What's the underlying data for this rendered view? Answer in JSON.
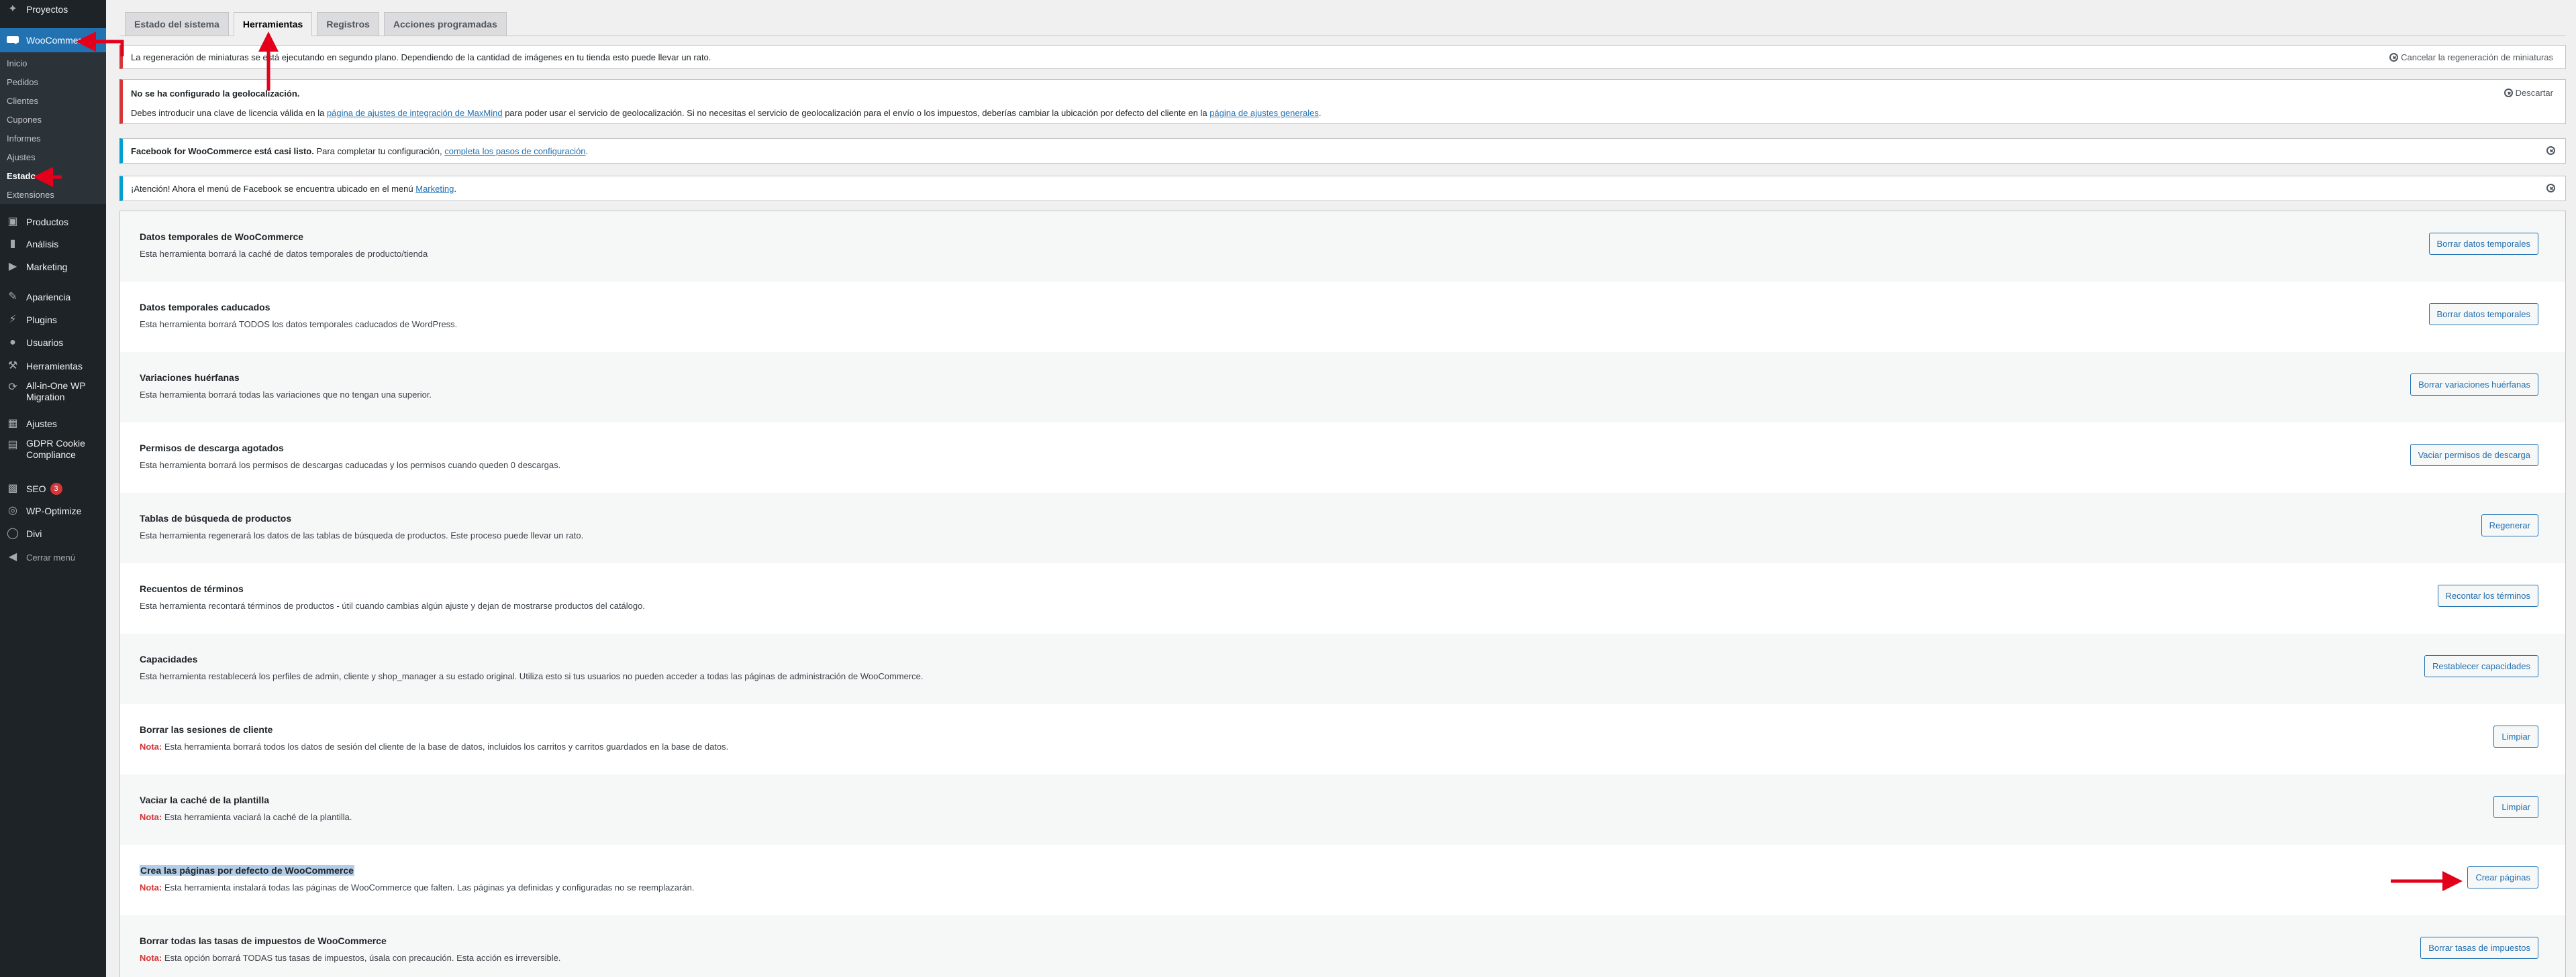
{
  "sidebar": {
    "top_items": [
      {
        "label": "Proyectos",
        "icon": "pin-icon"
      },
      {
        "label": "WooCommerce",
        "icon": "woocommerce-icon"
      }
    ],
    "submenu": [
      {
        "label": "Inicio"
      },
      {
        "label": "Pedidos"
      },
      {
        "label": "Clientes"
      },
      {
        "label": "Cupones"
      },
      {
        "label": "Informes"
      },
      {
        "label": "Ajustes"
      },
      {
        "label": "Estado"
      },
      {
        "label": "Extensiones"
      }
    ],
    "items": [
      {
        "label": "Productos",
        "icon": "archive-icon"
      },
      {
        "label": "Análisis",
        "icon": "chart-bar-icon"
      },
      {
        "label": "Marketing",
        "icon": "megaphone-icon"
      },
      {
        "label": "Apariencia",
        "icon": "paintbrush-icon"
      },
      {
        "label": "Plugins",
        "icon": "plugin-icon"
      },
      {
        "label": "Usuarios",
        "icon": "users-icon"
      },
      {
        "label": "Herramientas",
        "icon": "wrench-icon"
      },
      {
        "label": "All-in-One WP",
        "label2": "Migration",
        "icon": "migration-icon"
      },
      {
        "label": "Ajustes",
        "icon": "settings-icon"
      },
      {
        "label": "GDPR Cookie",
        "label2": "Compliance",
        "icon": "gdpr-icon"
      },
      {
        "label": "SEO",
        "badge": "3",
        "icon": "seo-icon"
      },
      {
        "label": "WP-Optimize",
        "icon": "optimize-icon"
      },
      {
        "label": "Divi",
        "icon": "divi-icon"
      },
      {
        "label": "Cerrar menú",
        "icon": "collapse-icon"
      }
    ]
  },
  "tabs": [
    {
      "label": "Estado del sistema"
    },
    {
      "label": "Herramientas"
    },
    {
      "label": "Registros"
    },
    {
      "label": "Acciones programadas"
    }
  ],
  "notices": {
    "regen": {
      "text": "La regeneración de miniaturas se está ejecutando en segundo plano. Dependiendo de la cantidad de imágenes en tu tienda esto puede llevar un rato.",
      "action": "Cancelar la regeneración de miniaturas"
    },
    "geo": {
      "title": "No se ha configurado la geolocalización.",
      "text_a": "Debes introducir una clave de licencia válida en la ",
      "link_a": "página de ajustes de integración de MaxMind",
      "text_b": " para poder usar el servicio de geolocalización. Si no necesitas el servicio de geolocalización para el envío o los impuestos, deberías cambiar la ubicación por defecto del cliente en la ",
      "link_b": "página de ajustes generales",
      "text_c": ".",
      "dismiss": "Descartar"
    },
    "facebook": {
      "bold": "Facebook for WooCommerce está casi listo.",
      "text": " Para completar tu configuración, ",
      "link": "completa los pasos de configuración",
      "end": "."
    },
    "attention": {
      "text": "¡Atención! Ahora el menú de Facebook se encuentra ubicado en el menú ",
      "link": "Marketing",
      "end": "."
    }
  },
  "tools": [
    {
      "title": "Datos temporales de WooCommerce",
      "desc": "Esta herramienta borrará la caché de datos temporales de producto/tienda",
      "button": "Borrar datos temporales"
    },
    {
      "title": "Datos temporales caducados",
      "desc": "Esta herramienta borrará TODOS los datos temporales caducados de WordPress.",
      "button": "Borrar datos temporales"
    },
    {
      "title": "Variaciones huérfanas",
      "desc": "Esta herramienta borrará todas las variaciones que no tengan una superior.",
      "button": "Borrar variaciones huérfanas"
    },
    {
      "title": "Permisos de descarga agotados",
      "desc": "Esta herramienta borrará los permisos de descargas caducadas y los permisos cuando queden 0 descargas.",
      "button": "Vaciar permisos de descarga"
    },
    {
      "title": "Tablas de búsqueda de productos",
      "desc": "Esta herramienta regenerará los datos de las tablas de búsqueda de productos. Este proceso puede llevar un rato.",
      "button": "Regenerar"
    },
    {
      "title": "Recuentos de términos",
      "desc": "Esta herramienta recontará términos de productos - útil cuando cambias algún ajuste y dejan de mostrarse productos del catálogo.",
      "button": "Recontar los términos"
    },
    {
      "title": "Capacidades",
      "desc": "Esta herramienta restablecerá los perfiles de admin, cliente y shop_manager a su estado original. Utiliza esto si tus usuarios no pueden acceder a todas las páginas de administración de WooCommerce.",
      "button": "Restablecer capacidades"
    },
    {
      "title": "Borrar las sesiones de cliente",
      "note": "Nota:",
      "desc": " Esta herramienta borrará todos los datos de sesión del cliente de la base de datos, incluidos los carritos y carritos guardados en la base de datos.",
      "button": "Limpiar"
    },
    {
      "title": "Vaciar la caché de la plantilla",
      "note": "Nota:",
      "desc": " Esta herramienta vaciará la caché de la plantilla.",
      "button": "Limpiar"
    },
    {
      "title": "Crea las páginas por defecto de WooCommerce",
      "note": "Nota:",
      "desc": " Esta herramienta instalará todas las páginas de WooCommerce que falten. Las páginas ya definidas y configuradas no se reemplazarán.",
      "button": "Crear páginas"
    },
    {
      "title": "Borrar todas las tasas de impuestos de WooCommerce",
      "note": "Nota:",
      "desc": " Esta opción borrará TODAS tus tasas de impuestos, úsala con precaución. Esta acción es irreversible.",
      "button": "Borrar tasas de impuestos"
    }
  ],
  "colors": {
    "sidebar_bg": "#1d2327",
    "active_menu": "#2271b1",
    "annotation_arrow": "#e3001b",
    "note_red": "#d63638",
    "highlight": "#b3cde8"
  }
}
